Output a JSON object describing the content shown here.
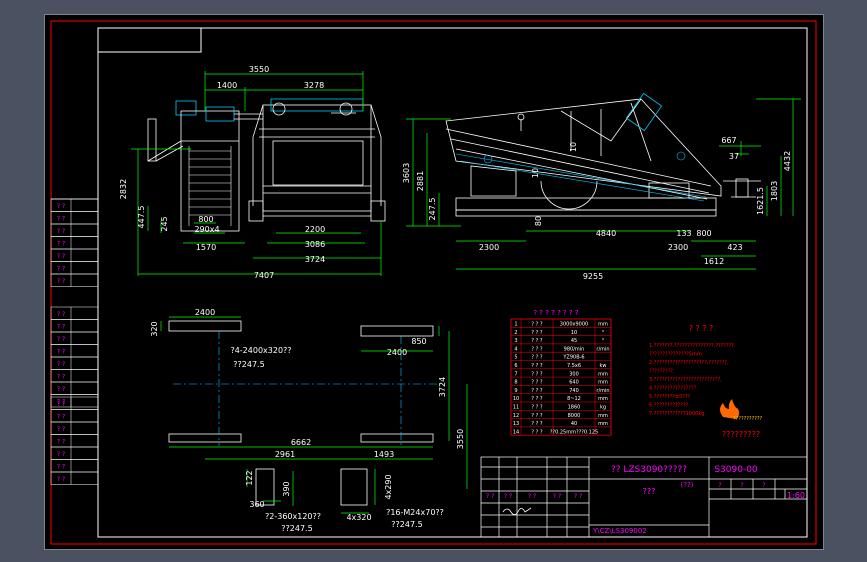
{
  "drawing": {
    "colors": {
      "background": "#000000",
      "frame": "#ffffff",
      "outline": "#ff0000",
      "dimension": "#00ff00",
      "text": "#ff00ff",
      "centerline": "#00c8ff",
      "structure": "#ffffff"
    },
    "front_view_dims": {
      "top_width": "3550",
      "left_part": "1400",
      "right_part": "3278",
      "height_total": "2832",
      "height_lower": "447.5",
      "base_height": "245",
      "plate_width": "800",
      "plate_spec": "290x4",
      "frame_width": "1570",
      "inner_width": "2200",
      "outer_width": "3086",
      "total_width": "3724",
      "overall_width": "7407"
    },
    "side_view_dims": {
      "height_total": "3603",
      "height_mid": "2881",
      "height_base": "247.5",
      "seg_1": "2300",
      "seg_2": "4840",
      "seg_3": "2300",
      "seg_4": "800",
      "total_length": "9255",
      "right_height": "4432",
      "right_mid": "1803",
      "right_small": "1621.5",
      "top_667": "667",
      "top_37": "37",
      "offset_423": "423",
      "offset_1612": "1612",
      "offset_133": "133",
      "label_10": "10",
      "label_10b": "10",
      "label_80": "80"
    },
    "foundation_plan": {
      "top_left_width": "2400",
      "left_height": "320",
      "spec_note": "?4-2400x320??",
      "level_note": "??247.5",
      "right_width": "2400",
      "right_height": "850",
      "height_3724": "3724",
      "height_3550": "3550",
      "span_6662": "6662",
      "dim_2961": "2961",
      "dim_1493": "1493",
      "detail_122": "122",
      "detail_360": "360",
      "detail_390": "390",
      "detail_note_1": "?2-360x120??",
      "detail_level_1": "??247.5",
      "detail_4x290": "4x290",
      "detail_4x320": "4x320",
      "detail_note_2": "?16-M24x70??",
      "detail_level_2": "??247.5"
    },
    "param_table": {
      "title": "? ? ? ? ? ? ? ?",
      "rows": [
        [
          "1",
          "? ? ?",
          "3000x9000",
          "mm"
        ],
        [
          "2",
          "? ? ?",
          "10",
          "°"
        ],
        [
          "3",
          "? ? ?",
          "45",
          "°"
        ],
        [
          "4",
          "? ? ?",
          "980/min",
          "r/min"
        ],
        [
          "5",
          "? ? ?",
          "YZ90B-6",
          ""
        ],
        [
          "6",
          "? ? ?",
          "7.5x6",
          "kw"
        ],
        [
          "7",
          "? ? ?",
          "300",
          "mm"
        ],
        [
          "8",
          "? ? ?",
          "640",
          "mm"
        ],
        [
          "9",
          "? ? ?",
          "740",
          "r/min"
        ],
        [
          "10",
          "? ? ?",
          "8~12",
          "mm"
        ],
        [
          "11",
          "? ? ?",
          "1860",
          "kg"
        ],
        [
          "12",
          "? ? ?",
          "8000",
          "mm"
        ],
        [
          "13",
          "? ? ?",
          "40",
          "mm"
        ],
        [
          "14",
          "? ? ?",
          "??0.25mm???0.125",
          ""
        ]
      ]
    },
    "notes": {
      "title": "? ? ? ?",
      "lines": [
        "1.???????,???????????????,???????,",
        "  ???????????????5mm.",
        "2.????????????????????,???????,",
        "  ?????????.",
        "3.?????????????????????????,",
        "4.????????????????.",
        "5.????????±0???",
        "6.?????????????.",
        "7.????????????1000kg."
      ]
    },
    "company_logo_text": "???????????",
    "company_name": "?????????",
    "title_block": {
      "title": "?? LZS3090?????",
      "part_no": "S3090-00",
      "subtitle": "???",
      "qty": "(??)",
      "scale": "1:60",
      "file_path": "Y\\CZ\\LS309002",
      "header_cells": [
        "? ?",
        "? ?",
        "? ?",
        "? ?",
        "? ?",
        "?",
        "?",
        "?"
      ]
    },
    "left_strip": [
      "? ?",
      "? ?",
      "? ?",
      "? ?",
      "? ?",
      "? ?",
      "? ?",
      "? ?",
      "? ?",
      "? ?",
      "? ?",
      "? ?",
      "? ?",
      "? ?",
      "? ?",
      "? ?",
      "? ?",
      "? ?",
      "? ?",
      "? ?",
      "? ?",
      "? ?"
    ]
  }
}
